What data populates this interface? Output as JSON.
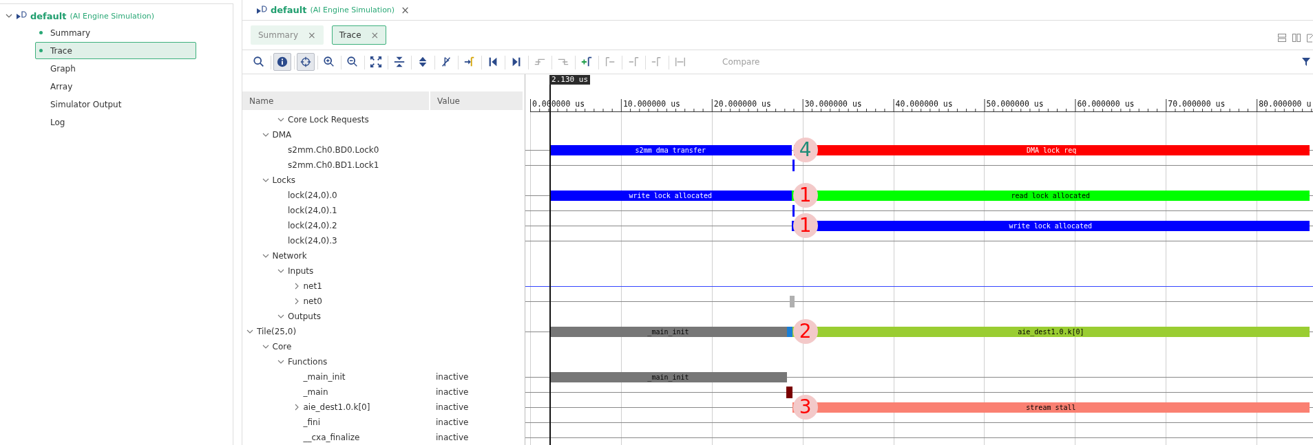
{
  "sidebar": {
    "name": "default",
    "subtitle": "(AI Engine Simulation)",
    "expanded": true,
    "items": [
      {
        "label": "Summary",
        "opened": true,
        "selected": false
      },
      {
        "label": "Trace",
        "opened": true,
        "selected": true
      },
      {
        "label": "Graph",
        "opened": false,
        "selected": false
      },
      {
        "label": "Array",
        "opened": false,
        "selected": false
      },
      {
        "label": "Simulator Output",
        "opened": false,
        "selected": false
      },
      {
        "label": "Log",
        "opened": false,
        "selected": false
      }
    ]
  },
  "editor": {
    "name": "default",
    "subtitle": "(AI Engine Simulation)",
    "close": "×"
  },
  "tabs": [
    {
      "label": "Summary",
      "close": "×",
      "selected": false
    },
    {
      "label": "Trace",
      "close": "×",
      "selected": true
    }
  ],
  "toolbar": [
    {
      "kind": "search",
      "selected": false,
      "disabled": false
    },
    {
      "kind": "info",
      "selected": true,
      "disabled": false
    },
    {
      "kind": "crosshair",
      "selected": true,
      "disabled": false
    },
    {
      "kind": "zoom-in",
      "selected": false,
      "disabled": false
    },
    {
      "kind": "zoom-out",
      "selected": false,
      "disabled": false
    },
    {
      "kind": "fit",
      "selected": false,
      "disabled": false
    },
    {
      "kind": "collapse",
      "selected": false,
      "disabled": false
    },
    {
      "kind": "expand",
      "selected": false,
      "disabled": false
    },
    {
      "kind": "unmark",
      "selected": false,
      "disabled": false
    },
    {
      "kind": "add-marker",
      "selected": false,
      "disabled": false
    },
    {
      "kind": "first",
      "selected": false,
      "disabled": false
    },
    {
      "kind": "last",
      "selected": false,
      "disabled": false
    },
    {
      "kind": "prev-edge",
      "selected": false,
      "disabled": true
    },
    {
      "kind": "next-edge",
      "selected": false,
      "disabled": true
    },
    {
      "kind": "add-cursor",
      "selected": false,
      "disabled": false
    },
    {
      "kind": "cursor-left",
      "selected": false,
      "disabled": true
    },
    {
      "kind": "cursor-right",
      "selected": false,
      "disabled": true
    },
    {
      "kind": "cursor-remove",
      "selected": false,
      "disabled": true
    },
    {
      "kind": "cursor-range",
      "selected": false,
      "disabled": true
    },
    {
      "kind": "text",
      "label": "Compare",
      "selected": false,
      "disabled": true
    }
  ],
  "columns": {
    "name": "Name",
    "value": "Value"
  },
  "ruler": {
    "ticks": [
      "0.000000 us",
      "10.000000 us",
      "20.000000 us",
      "30.000000 us",
      "40.000000 us",
      "50.000000 us",
      "60.000000 us",
      "70.000000 us",
      "80.000000 u"
    ],
    "cursor": {
      "label": "2.130 us"
    }
  },
  "tree": [
    {
      "children": [
        {
          "children": [
            {
              "name": "Core Lock Requests",
              "expanded": true
            }
          ]
        },
        {
          "name": "DMA",
          "expanded": true,
          "children": [
            {
              "name": "s2mm.Ch0.BD0.Lock0",
              "kind": "line",
              "segments": [
                {
                  "kind": "bar",
                  "color": "#0000ff",
                  "label": "s2mm dma transfer"
                },
                {
                  "kind": "bar",
                  "color": "#ff0000",
                  "label": "DMA lock req"
                }
              ],
              "marker": {
                "text": "4",
                "color": "#1e8c78"
              }
            },
            {
              "name": "s2mm.Ch0.BD1.Lock1",
              "kind": "line",
              "segments": [
                {
                  "kind": "pulse",
                  "color": "#0000ff"
                }
              ]
            }
          ]
        },
        {
          "name": "Locks",
          "expanded": true,
          "children": [
            {
              "name": "lock(24,0).0",
              "kind": "line",
              "segments": [
                {
                  "kind": "bar",
                  "color": "#0000ff",
                  "label": "write lock allocated"
                },
                {
                  "kind": "bar",
                  "color": "#00ff00",
                  "label": "read lock allocated"
                }
              ],
              "marker": {
                "text": "1",
                "color": "#ff0000"
              }
            },
            {
              "name": "lock(24,0).1",
              "kind": "line",
              "segments": [
                {
                  "kind": "pulse",
                  "color": "#0000ff"
                }
              ]
            },
            {
              "name": "lock(24,0).2",
              "kind": "line",
              "segments": [
                {
                  "kind": "bar",
                  "color": "#0000ff",
                  "label": "write lock allocated"
                }
              ],
              "marker": {
                "text": "1",
                "color": "#ff0000"
              }
            },
            {
              "name": "lock(24,0).3",
              "kind": "line"
            }
          ]
        },
        {
          "name": "Network",
          "expanded": true,
          "children": [
            {
              "name": "Inputs",
              "expanded": true,
              "children": [
                {
                  "name": "net1",
                  "expanded": false,
                  "kind": "bus"
                },
                {
                  "name": "net0",
                  "expanded": false,
                  "kind": "line",
                  "segments": [
                    {
                      "kind": "pulse",
                      "color": "#b0b0b0"
                    }
                  ]
                }
              ]
            },
            {
              "name": "Outputs",
              "expanded": true
            }
          ]
        }
      ]
    },
    {
      "name": "Tile(25,0)",
      "expanded": true,
      "kind": "line",
      "segments": [
        {
          "kind": "bar",
          "color": "#777777",
          "label": "_main_init"
        },
        {
          "kind": "bar",
          "color": "#1a7fd6"
        },
        {
          "kind": "bar",
          "color": "#9acd32",
          "label": "aie_dest1.0.k[0]"
        }
      ],
      "marker": {
        "text": "2",
        "color": "#ff0000"
      },
      "children": [
        {
          "name": "Core",
          "expanded": true,
          "children": [
            {
              "name": "Functions",
              "expanded": true,
              "children": [
                {
                  "name": "_main_init",
                  "value": "inactive",
                  "kind": "line",
                  "segments": [
                    {
                      "kind": "bar",
                      "color": "#777777",
                      "label": "_main_init"
                    }
                  ]
                },
                {
                  "name": "_main",
                  "value": "inactive",
                  "kind": "line",
                  "segments": [
                    {
                      "kind": "pulse",
                      "color": "#7a0000"
                    }
                  ]
                },
                {
                  "name": "aie_dest1.0.k[0]",
                  "value": "inactive",
                  "expanded": false,
                  "kind": "line",
                  "segments": [
                    {
                      "kind": "bar",
                      "color": "#fa8072",
                      "label": "stream stall"
                    }
                  ],
                  "marker": {
                    "text": "3",
                    "color": "#ff0000"
                  }
                },
                {
                  "name": "_fini",
                  "value": "inactive",
                  "kind": "line"
                },
                {
                  "name": "__cxa_finalize",
                  "value": "inactive",
                  "kind": "line"
                }
              ]
            }
          ]
        }
      ]
    }
  ]
}
